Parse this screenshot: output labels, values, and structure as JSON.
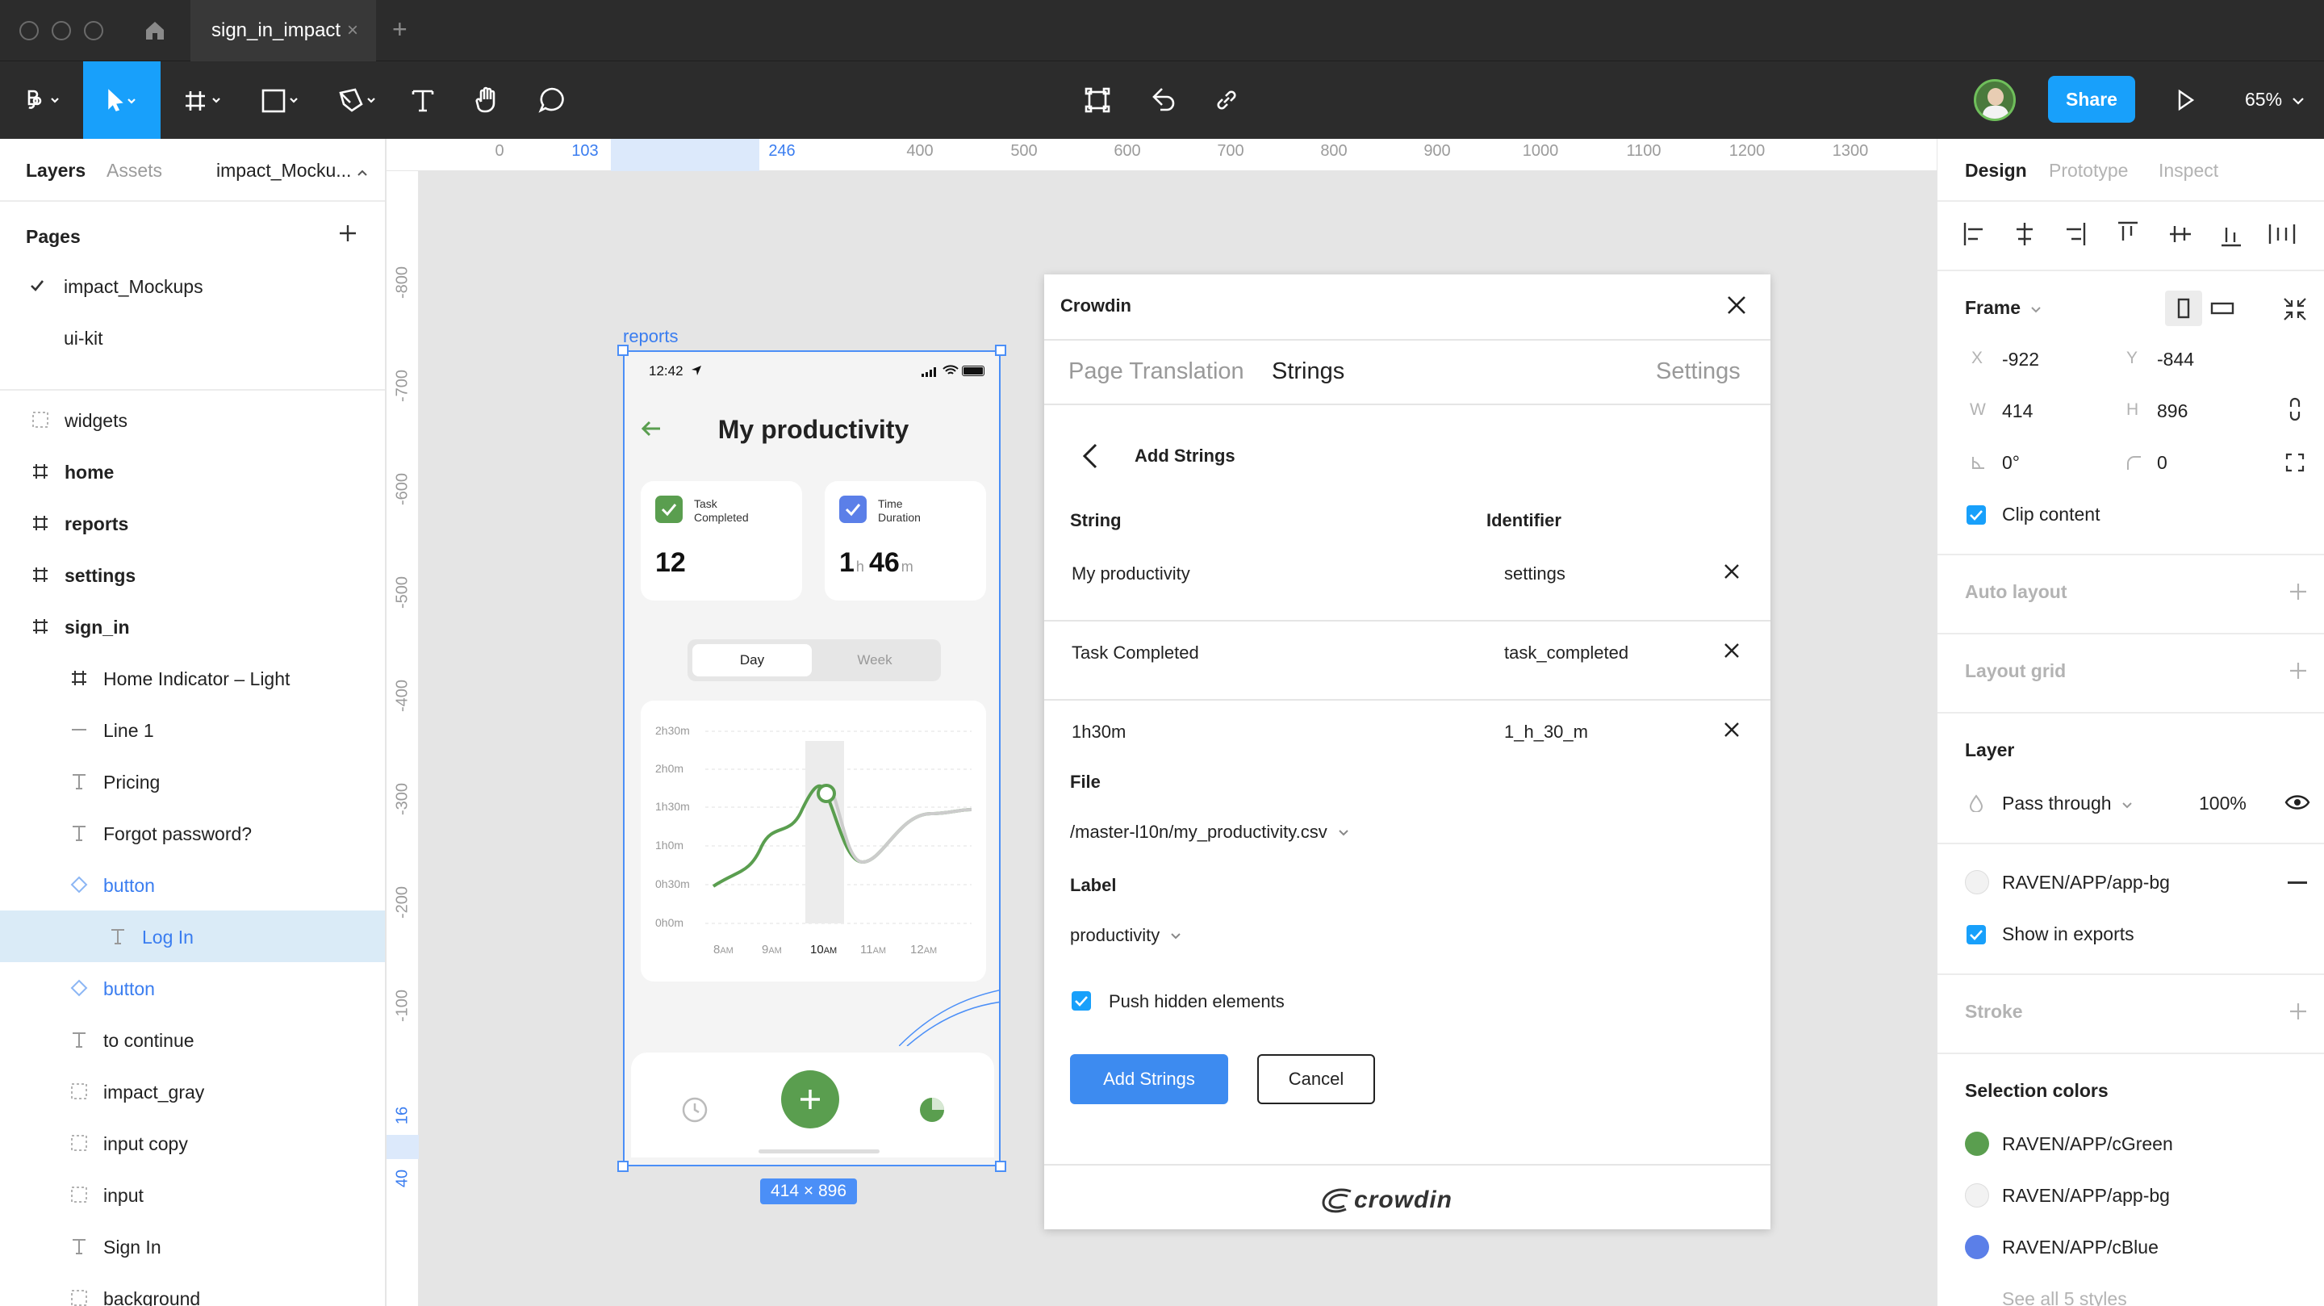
{
  "titlebar": {
    "tab_title": "sign_in_impact",
    "tab_close": "×",
    "new_tab": "+"
  },
  "toolbar": {
    "share_label": "Share",
    "zoom_label": "65%"
  },
  "left_panel": {
    "tabs": {
      "layers": "Layers",
      "assets": "Assets",
      "page_picker": "impact_Mocku..."
    },
    "pages_title": "Pages",
    "pages": [
      "impact_Mockups",
      "ui-kit"
    ],
    "layers": [
      {
        "name": "widgets",
        "icon": "component-group-icon"
      },
      {
        "name": "home",
        "icon": "frame-icon"
      },
      {
        "name": "reports",
        "icon": "frame-icon"
      },
      {
        "name": "settings",
        "icon": "frame-icon"
      },
      {
        "name": "sign_in",
        "icon": "frame-icon"
      },
      {
        "name": "Home Indicator – Light",
        "icon": "frame-icon"
      },
      {
        "name": "Line 1",
        "icon": "line-icon"
      },
      {
        "name": "Pricing",
        "icon": "text-icon"
      },
      {
        "name": "Forgot password?",
        "icon": "text-icon"
      },
      {
        "name": "button",
        "icon": "instance-icon"
      },
      {
        "name": "Log In",
        "icon": "text-icon"
      },
      {
        "name": "button",
        "icon": "instance-icon"
      },
      {
        "name": "to continue",
        "icon": "text-icon"
      },
      {
        "name": "impact_gray",
        "icon": "component-group-icon"
      },
      {
        "name": "input copy",
        "icon": "component-group-icon"
      },
      {
        "name": "input",
        "icon": "component-group-icon"
      },
      {
        "name": "Sign In",
        "icon": "text-icon"
      },
      {
        "name": "background",
        "icon": "component-group-icon"
      }
    ]
  },
  "rulers": {
    "top": [
      "0",
      "103",
      "246",
      "400",
      "500",
      "600",
      "700",
      "800",
      "900",
      "1000",
      "1100",
      "1200",
      "1300"
    ],
    "left": [
      "-800",
      "-700",
      "-600",
      "-500",
      "-400",
      "-300",
      "-200",
      "-100",
      "16",
      "40"
    ]
  },
  "canvas": {
    "frame_label": "reports",
    "size_badge": "414 × 896",
    "phone": {
      "time": "12:42",
      "title": "My productivity",
      "card1_label_1": "Task",
      "card1_label_2": "Completed",
      "card1_value": "12",
      "card2_label_1": "Time",
      "card2_label_2": "Duration",
      "card2_hours": "1",
      "card2_h_unit": "h",
      "card2_minutes": "46",
      "card2_m_unit": "m",
      "toggle_day": "Day",
      "toggle_week": "Week",
      "chart_ylabels": [
        "2h30m",
        "2h0m",
        "1h30m",
        "1h0m",
        "0h30m",
        "0h0m"
      ],
      "chart_xlabels": [
        {
          "num": "8",
          "unit": "AM"
        },
        {
          "num": "9",
          "unit": "AM"
        },
        {
          "num": "10",
          "unit": "AM"
        },
        {
          "num": "11",
          "unit": "AM"
        },
        {
          "num": "12",
          "unit": "AM"
        }
      ]
    }
  },
  "dialog": {
    "title": "Crowdin",
    "tabs": {
      "page_translation": "Page Translation",
      "strings": "Strings",
      "settings": "Settings"
    },
    "back_title": "Add Strings",
    "col_string": "String",
    "col_identifier": "Identifier",
    "rows": [
      {
        "string": "My productivity",
        "identifier": "settings"
      },
      {
        "string": "Task Completed",
        "identifier": "task_completed"
      },
      {
        "string": "1h30m",
        "identifier": "1_h_30_m"
      }
    ],
    "file_label": "File",
    "file_value": "/master-l10n/my_productivity.csv",
    "label_label": "Label",
    "label_value": "productivity",
    "push_hidden": "Push hidden elements",
    "add_button": "Add Strings",
    "cancel_button": "Cancel",
    "footer_logo": "crowdin"
  },
  "right_panel": {
    "tabs": {
      "design": "Design",
      "prototype": "Prototype",
      "inspect": "Inspect"
    },
    "frame_title": "Frame",
    "x_label": "X",
    "x_value": "-922",
    "y_label": "Y",
    "y_value": "-844",
    "w_label": "W",
    "w_value": "414",
    "h_label": "H",
    "h_value": "896",
    "rotation": "0°",
    "radius": "0",
    "clip_content": "Clip content",
    "auto_layout": "Auto layout",
    "layout_grid": "Layout grid",
    "layer_title": "Layer",
    "blend_mode": "Pass through",
    "opacity": "100%",
    "fill_style": "RAVEN/APP/app-bg",
    "show_in_exports": "Show in exports",
    "stroke": "Stroke",
    "selection_colors": "Selection colors",
    "colors": [
      {
        "name": "RAVEN/APP/cGreen",
        "color": "#5a9e4f"
      },
      {
        "name": "RAVEN/APP/app-bg",
        "color": "#f2f2f2"
      },
      {
        "name": "RAVEN/APP/cBlue",
        "color": "#5b7fe8"
      }
    ],
    "see_all": "See all 5 styles"
  },
  "colors": {
    "accent": "#18a0fb",
    "selection": "#4b8ff7",
    "green": "#5a9e4f",
    "blue": "#5b7fe8"
  }
}
